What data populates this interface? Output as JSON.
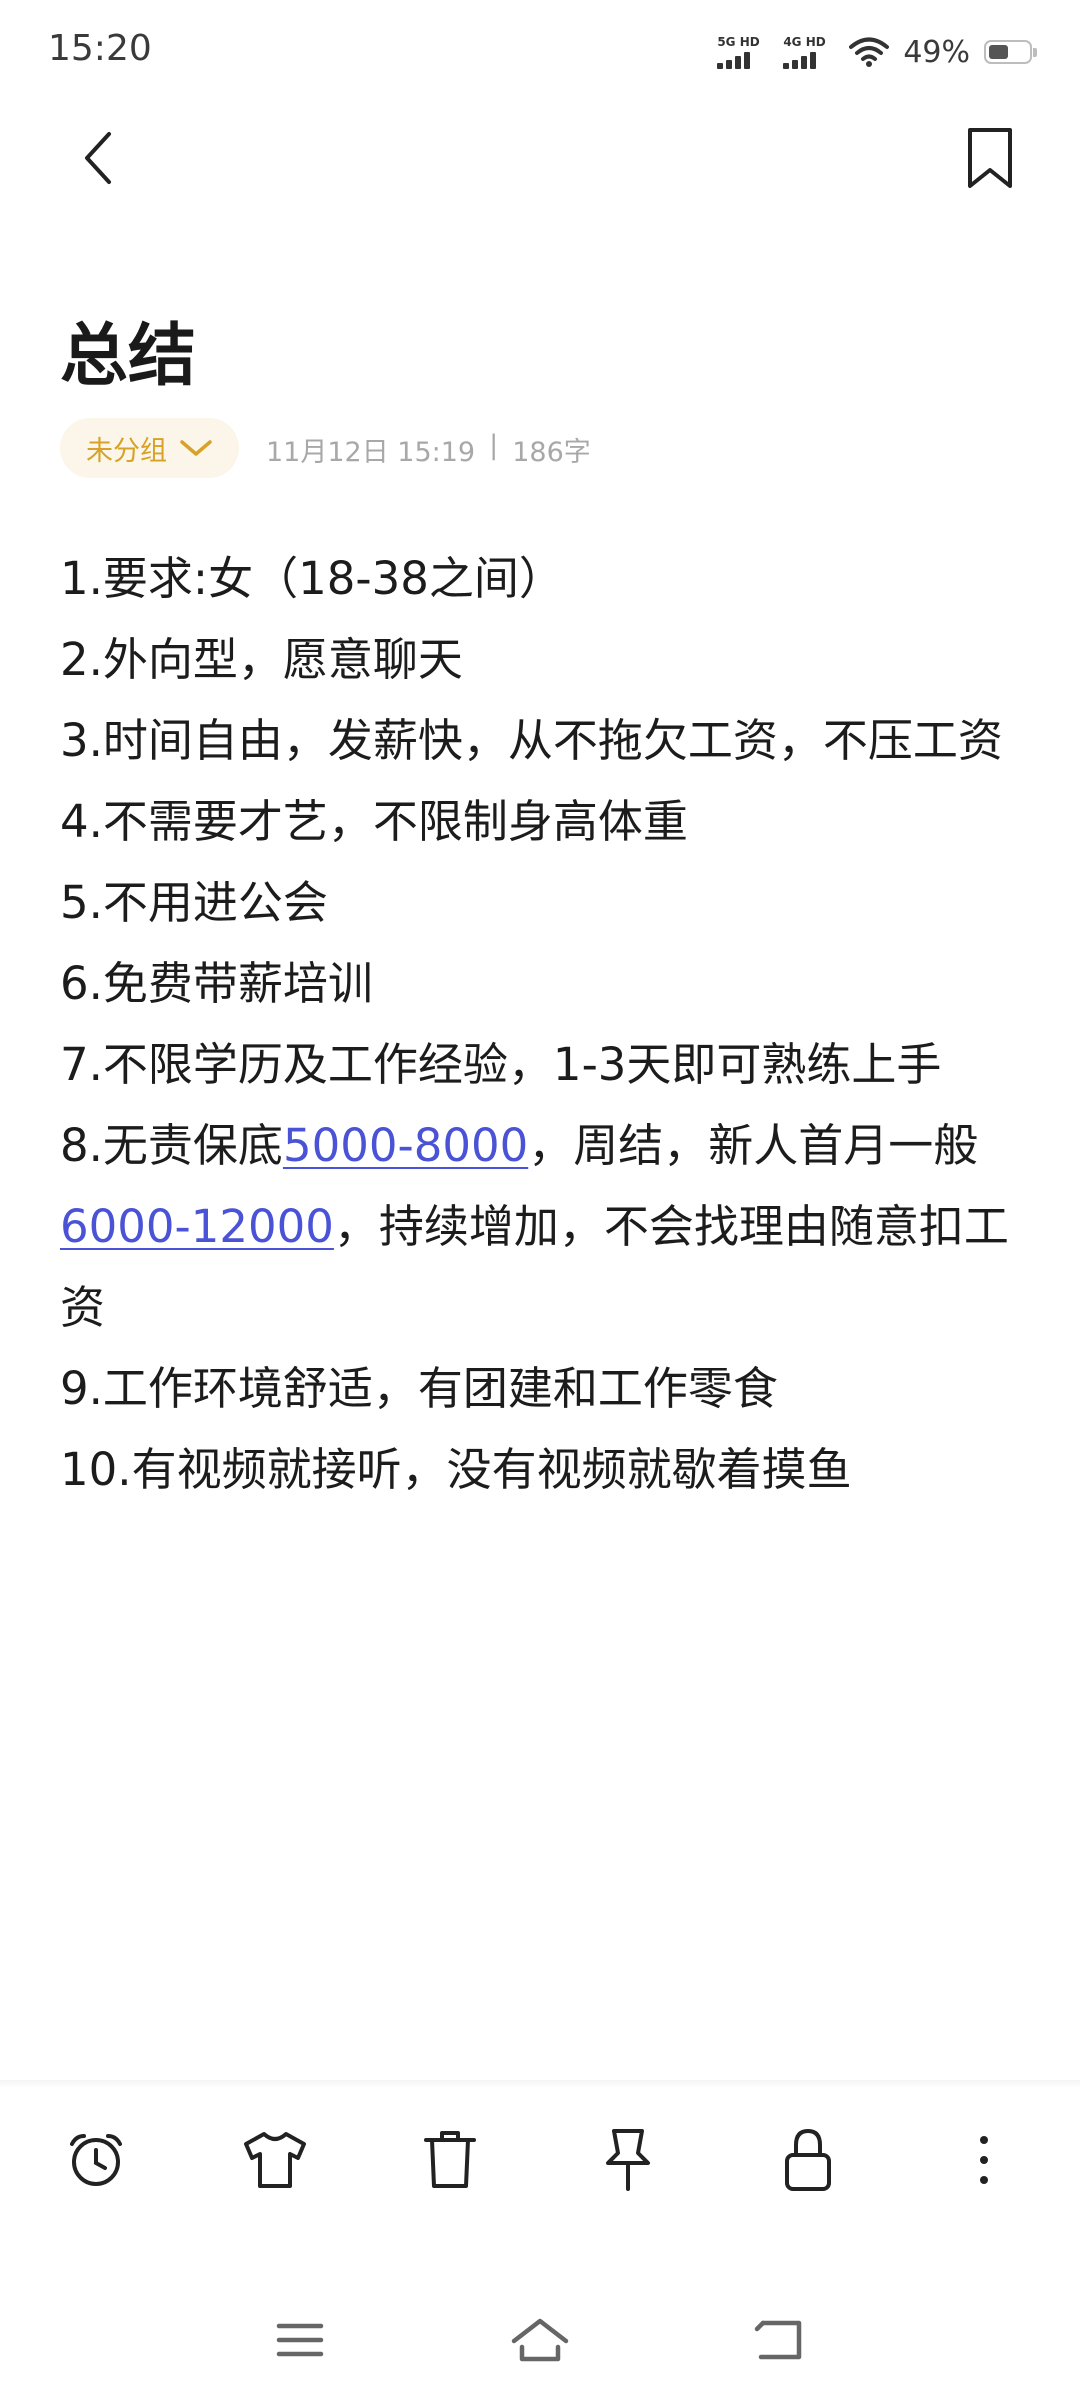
{
  "status_bar": {
    "time": "15:20",
    "network1": "5G HD",
    "network2": "4G HD",
    "battery": "49%",
    "battery_level": 0.49
  },
  "note": {
    "title": "总结",
    "group": "未分组",
    "date": "11月12日 15:19",
    "separator": "|",
    "word_count": "186字",
    "lines": [
      "1.要求:女（18-38之间）",
      "2.外向型，愿意聊天",
      "3.时间自由，发薪快，从不拖欠工资，不压工资",
      "4.不需要才艺，不限制身高体重",
      "5.不用进公会",
      "6.免费带薪培训",
      "7.不限学历及工作经验，1-3天即可熟练上手"
    ],
    "line8": {
      "a": "8.无责保底",
      "link1": "5000-8000",
      "b": "，周结，新人首月一般",
      "link2": "6000-12000",
      "c": "，持续增加，不会找理由随意扣工资"
    },
    "lines_end": [
      "9.工作环境舒适，有团建和工作零食",
      "10.有视频就接听，没有视频就歇着摸鱼"
    ]
  },
  "toolbar": {
    "icons": [
      "alarm-icon",
      "shirt-icon",
      "trash-icon",
      "pin-icon",
      "lock-icon",
      "more-icon"
    ]
  },
  "navbar": {
    "icons": [
      "menu-icon",
      "home-icon",
      "back-nav-icon"
    ]
  },
  "colors": {
    "accent": "#d7a227",
    "link": "#4a52d6",
    "meta": "#a8a8a8"
  }
}
